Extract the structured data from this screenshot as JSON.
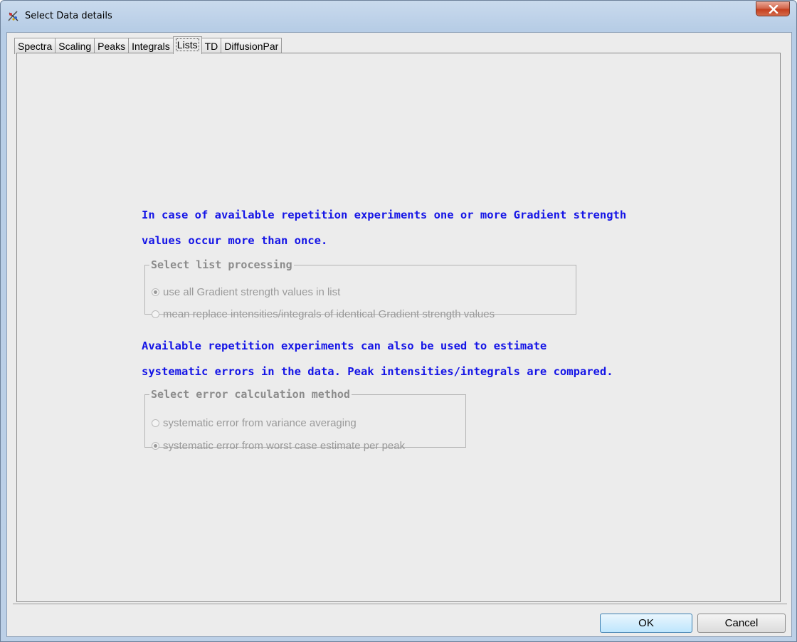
{
  "window": {
    "title": "Select Data details",
    "close_glyph": "✕"
  },
  "tabs": [
    {
      "label": "Spectra",
      "active": false
    },
    {
      "label": "Scaling",
      "active": false
    },
    {
      "label": "Peaks",
      "active": false
    },
    {
      "label": "Integrals",
      "active": false
    },
    {
      "label": "Lists",
      "active": true
    },
    {
      "label": "TD",
      "active": false
    },
    {
      "label": "DiffusionPar",
      "active": false
    }
  ],
  "lists_panel": {
    "info1_line1": "In case of available repetition experiments one or more Gradient strength",
    "info1_line2": "values occur more than once.",
    "list_processing": {
      "title": "Select list processing",
      "options": [
        {
          "label": "use all Gradient strength values in list",
          "selected": true
        },
        {
          "label": "mean replace intensities/integrals of identical Gradient strength values",
          "selected": false
        }
      ]
    },
    "info2_line1": "Available repetition experiments can also be used to estimate",
    "info2_line2": "systematic errors in the data. Peak intensities/integrals are compared.",
    "error_method": {
      "title": "Select error calculation method",
      "options": [
        {
          "label": "systematic error from variance averaging",
          "selected": false
        },
        {
          "label": "systematic error from worst case estimate per peak",
          "selected": true
        }
      ]
    }
  },
  "buttons": {
    "ok": "OK",
    "cancel": "Cancel"
  },
  "colors": {
    "info_text": "#1414e6",
    "disabled_text": "#9a9a9a"
  }
}
